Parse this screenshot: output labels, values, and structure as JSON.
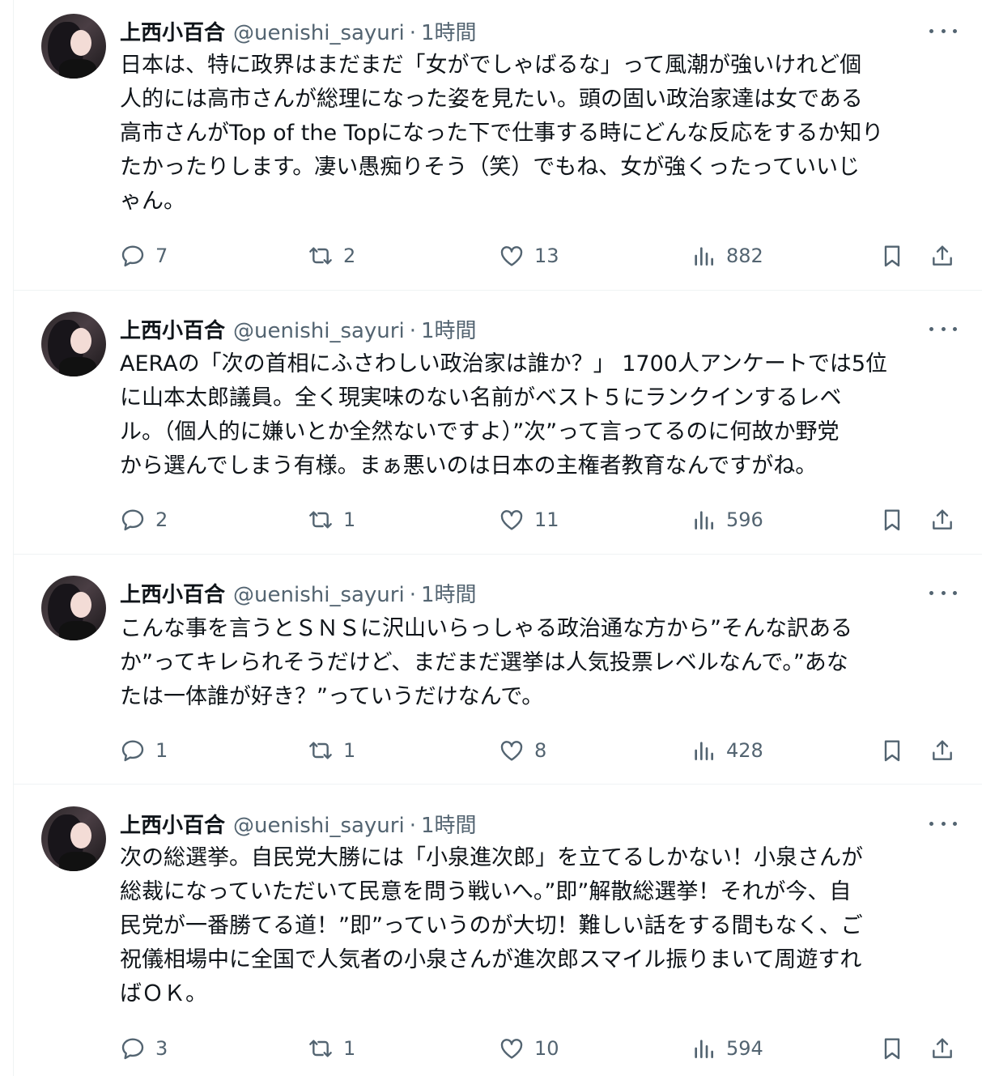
{
  "tweets": [
    {
      "name": "上西小百合",
      "handle": "@uenishi_sayuri",
      "separator": "·",
      "time": "1時間",
      "text": "日本は、特に政界はまだまだ「女がでしゃばるな」って風潮が強いけれど個\n人的には高市さんが総理になった姿を見たい。頭の固い政治家達は女である\n高市さんがTop of the Topになった下で仕事する時にどんな反応をするか知り\nたかったりします。凄い愚痴りそう（笑）でもね、女が強くったっていいじ\nゃん。",
      "replies": "7",
      "reposts": "2",
      "likes": "13",
      "views": "882"
    },
    {
      "name": "上西小百合",
      "handle": "@uenishi_sayuri",
      "separator": "·",
      "time": "1時間",
      "text": "AERAの「次の首相にふさわしい政治家は誰か？」 1700人アンケートでは5位\nに山本太郎議員。全く現実味のない名前がベスト５にランクインするレベ\nル。（個人的に嫌いとか全然ないですよ）”次”って言ってるのに何故か野党\nから選んでしまう有様。まぁ悪いのは日本の主権者教育なんですがね。",
      "replies": "2",
      "reposts": "1",
      "likes": "11",
      "views": "596"
    },
    {
      "name": "上西小百合",
      "handle": "@uenishi_sayuri",
      "separator": "·",
      "time": "1時間",
      "text": "こんな事を言うとＳＮＳに沢山いらっしゃる政治通な方から”そんな訳ある\nか”ってキレられそうだけど、まだまだ選挙は人気投票レベルなんで。”あな\nたは一体誰が好き？”っていうだけなんで。",
      "replies": "1",
      "reposts": "1",
      "likes": "8",
      "views": "428"
    },
    {
      "name": "上西小百合",
      "handle": "@uenishi_sayuri",
      "separator": "·",
      "time": "1時間",
      "text": "次の総選挙。自民党大勝には「小泉進次郎」を立てるしかない！小泉さんが\n総裁になっていただいて民意を問う戦いへ。”即”解散総選挙！それが今、自\n民党が一番勝てる道！”即”っていうのが大切！難しい話をする間もなく、ご\n祝儀相場中に全国で人気者の小泉さんが進次郎スマイル振りまいて周遊すれ\nばＯＫ。",
      "replies": "3",
      "reposts": "1",
      "likes": "10",
      "views": "594"
    }
  ]
}
